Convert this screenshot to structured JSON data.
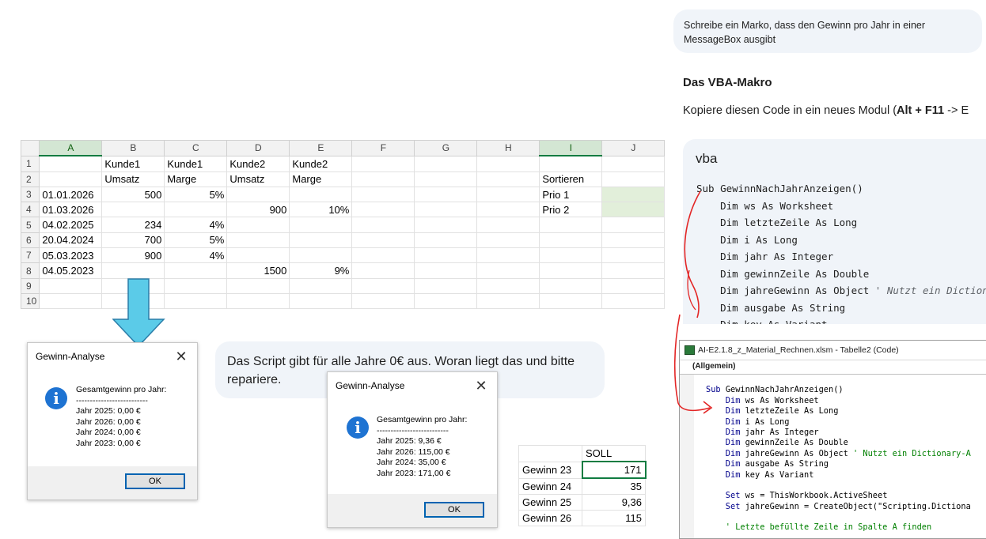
{
  "excel": {
    "columns": [
      "",
      "A",
      "B",
      "C",
      "D",
      "E",
      "F",
      "G",
      "H",
      "I",
      "J"
    ],
    "rows": [
      {
        "n": "1",
        "A": "",
        "B": "Kunde1",
        "C": "Kunde1",
        "D": "Kunde2",
        "E": "Kunde2",
        "I": "",
        "J": ""
      },
      {
        "n": "2",
        "A": "",
        "B": "Umsatz",
        "C": "Marge",
        "D": "Umsatz",
        "E": "Marge",
        "I": "Sortieren",
        "J": ""
      },
      {
        "n": "3",
        "A": "01.01.2026",
        "B": "500",
        "C": "5%",
        "D": "",
        "E": "",
        "I": "Prio 1",
        "J": ""
      },
      {
        "n": "4",
        "A": "01.03.2026",
        "B": "",
        "C": "",
        "D": "900",
        "E": "10%",
        "I": "Prio 2",
        "J": ""
      },
      {
        "n": "5",
        "A": "04.02.2025",
        "B": "234",
        "C": "4%",
        "D": "",
        "E": "",
        "I": "",
        "J": ""
      },
      {
        "n": "6",
        "A": "20.04.2024",
        "B": "700",
        "C": "5%",
        "D": "",
        "E": "",
        "I": "",
        "J": ""
      },
      {
        "n": "7",
        "A": "05.03.2023",
        "B": "900",
        "C": "4%",
        "D": "",
        "E": "",
        "I": "",
        "J": ""
      },
      {
        "n": "8",
        "A": "04.05.2023",
        "B": "",
        "C": "",
        "D": "1500",
        "E": "9%",
        "I": "",
        "J": ""
      },
      {
        "n": "9",
        "A": "",
        "B": "",
        "C": "",
        "D": "",
        "E": "",
        "I": "",
        "J": ""
      },
      {
        "n": "10",
        "A": "",
        "B": "",
        "C": "",
        "D": "",
        "E": "",
        "I": "",
        "J": ""
      }
    ]
  },
  "msgbox_before": {
    "title": "Gewinn-Analyse",
    "message": "Gesamtgewinn pro Jahr:\n--------------------------\nJahr 2025: 0,00 €\nJahr 2026: 0,00 €\nJahr 2024: 0,00 €\nJahr 2023: 0,00 €",
    "ok": "OK"
  },
  "msgbox_after": {
    "title": "Gewinn-Analyse",
    "message": "Gesamtgewinn pro Jahr:\n--------------------------\nJahr 2025: 9,36 €\nJahr 2026: 115,00 €\nJahr 2024: 35,00 €\nJahr 2023: 171,00 €",
    "ok": "OK"
  },
  "chat": {
    "user_prompt_1": "Schreibe ein Marko, dass den Gewinn pro Jahr in einer MessageBox ausgibt",
    "user_prompt_2": "Das Script gibt für alle Jahre 0€ aus. Woran liegt das und bitte repariere.",
    "heading": "Das VBA-Makro",
    "intro_prefix": "Kopiere diesen Code in ein neues Modul (",
    "intro_bold": "Alt + F11",
    "intro_suffix": " -> E",
    "code_lang": "vba",
    "code_lines": [
      "Sub GewinnNachJahrAnzeigen()",
      "    Dim ws As Worksheet",
      "    Dim letzteZeile As Long",
      "    Dim i As Long",
      "    Dim jahr As Integer",
      "    Dim gewinnZeile As Double",
      "    Dim jahreGewinn As Object",
      "    Dim ausgabe As String",
      "    Dim key As Variant"
    ],
    "code_comment": " ' Nutzt ein Diction"
  },
  "soll": {
    "header": "SOLL",
    "rows": [
      {
        "label": "Gewinn 23",
        "value": "171"
      },
      {
        "label": "Gewinn 24",
        "value": "35"
      },
      {
        "label": "Gewinn 25",
        "value": "9,36"
      },
      {
        "label": "Gewinn 26",
        "value": "115"
      }
    ]
  },
  "vbe": {
    "title": "AI-E2.1.8_z_Material_Rechnen.xlsm - Tabelle2 (Code)",
    "object_dropdown": "(Allgemein)",
    "lines": [
      {
        "k": "",
        "t": ""
      },
      {
        "k": "Sub ",
        "t": "GewinnNachJahrAnzeigen()"
      },
      {
        "k": "    Dim ",
        "t": "ws As Worksheet"
      },
      {
        "k": "    Dim ",
        "t": "letzteZeile As Long"
      },
      {
        "k": "    Dim ",
        "t": "i As Long"
      },
      {
        "k": "    Dim ",
        "t": "jahr As Integer"
      },
      {
        "k": "    Dim ",
        "t": "gewinnZeile As Double"
      },
      {
        "k": "    Dim ",
        "t": "jahreGewinn As Object",
        "c": " ' Nutzt ein Dictionary-A"
      },
      {
        "k": "    Dim ",
        "t": "ausgabe As String"
      },
      {
        "k": "    Dim ",
        "t": "key As Variant"
      },
      {
        "k": "",
        "t": ""
      },
      {
        "k": "    Set ",
        "t": "ws = ThisWorkbook.ActiveSheet"
      },
      {
        "k": "    Set ",
        "t": "jahreGewinn = CreateObject(\"Scripting.Dictiona"
      },
      {
        "k": "",
        "t": ""
      },
      {
        "k": "",
        "t": "",
        "c": "    ' Letzte befüllte Zeile in Spalte A finden"
      }
    ]
  }
}
